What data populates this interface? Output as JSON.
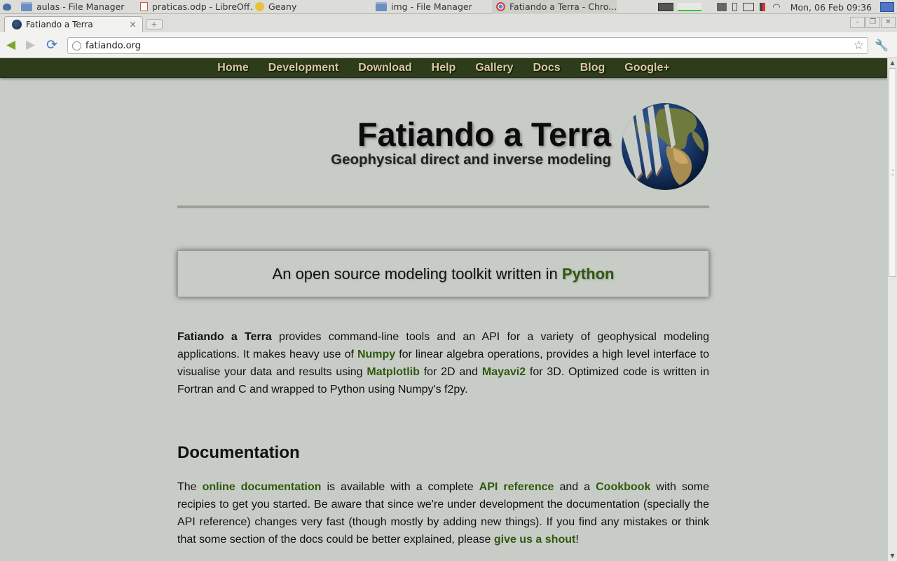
{
  "taskbar": {
    "tasks": [
      {
        "label": "aulas - File Manager",
        "icon": "folder-icon"
      },
      {
        "label": "praticas.odp - LibreOff...",
        "icon": "document-icon"
      },
      {
        "label": "Geany",
        "icon": "geany-icon"
      },
      {
        "label": "img - File Manager",
        "icon": "folder-icon"
      },
      {
        "label": "Fatiando a Terra - Chro...",
        "icon": "chrome-icon"
      }
    ],
    "clock": "Mon, 06 Feb  09:36"
  },
  "browser": {
    "tab_title": "Fatiando a Terra",
    "tab_close": "×",
    "new_tab": "+",
    "url": "fatiando.org",
    "back": "◀",
    "forward": "▶",
    "reload": "⟳",
    "star": "☆",
    "wrench": "🔧",
    "minimize": "–",
    "restore": "❐",
    "close": "✕"
  },
  "nav": {
    "items": [
      "Home",
      "Development",
      "Download",
      "Help",
      "Gallery",
      "Docs",
      "Blog",
      "Google+"
    ]
  },
  "header": {
    "title": "Fatiando a Terra",
    "subtitle": "Geophysical direct and inverse modeling"
  },
  "tagline": {
    "text": "An open source modeling toolkit written in ",
    "link": "Python"
  },
  "intro": {
    "bold": "Fatiando a Terra",
    "t1": " provides command-line tools and an API for a variety of geophysical modeling applications. It makes heavy use of ",
    "link1": "Numpy",
    "t2": " for linear algebra operations, provides a high level interface to visualise your data and results using ",
    "link2": "Matplotlib",
    "t3": " for 2D and ",
    "link3": "Mayavi2",
    "t4": " for 3D. Optimized code is written in Fortran and C and wrapped to Python using Numpy's f2py."
  },
  "documentation": {
    "heading": "Documentation",
    "t1": "The ",
    "link1": "online documentation",
    "t2": " is available with a complete ",
    "link2": "API reference",
    "t3": " and a ",
    "link3": "Cookbook",
    "t4": " with some recipies to get you started. Be aware that since we're under development the documentation (specially the API reference) changes very fast (though mostly by adding new things). If you find any mistakes or think that some section of the docs could be better explained, please ",
    "link4": "give us a shout",
    "t5": "!"
  },
  "colors": {
    "page_bg": "#c8ccc6",
    "nav_bg": "#2d3d1c",
    "nav_text": "#d9c9a0",
    "link": "#2e5a0e"
  }
}
